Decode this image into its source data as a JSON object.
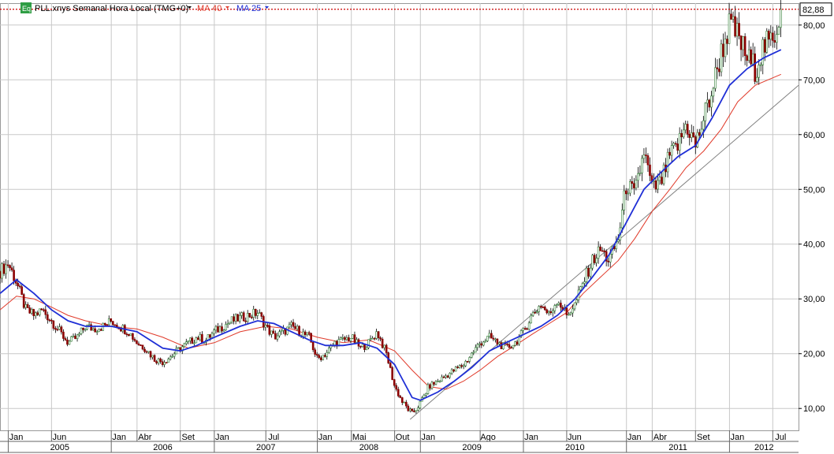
{
  "header": {
    "badge": "Eq",
    "symbol": "PLL.xnys Semanal Hora Local (TMG+0)",
    "ma40_label": "MA 40",
    "ma25_label": "MA 25"
  },
  "last_price": "82,88",
  "colors": {
    "candle_up": "#2e7d32",
    "candle_down": "#8b0000",
    "ma25": "#1f2fd6",
    "ma40": "#e03a2a",
    "trendline": "#808080",
    "last_price_line": "#cc0000",
    "grid": "#c8c8c8",
    "badge_bg": "#2f9e44"
  },
  "chart_data": {
    "type": "candlestick",
    "title": "",
    "ylim": [
      6,
      84
    ],
    "y_ticks": [
      "10,00",
      "20,00",
      "30,00",
      "40,00",
      "50,00",
      "60,00",
      "70,00",
      "80,00"
    ],
    "y_tick_values": [
      10,
      20,
      30,
      40,
      50,
      60,
      70,
      80
    ],
    "x_range": [
      2004.92,
      2012.67
    ],
    "month_ticks": [
      {
        "label": "Jan",
        "t": 2005.0
      },
      {
        "label": "Jun",
        "t": 2005.42
      },
      {
        "label": "Jan",
        "t": 2006.0
      },
      {
        "label": "Abr",
        "t": 2006.25
      },
      {
        "label": "Set",
        "t": 2006.67
      },
      {
        "label": "Jan",
        "t": 2007.0
      },
      {
        "label": "Jul",
        "t": 2007.5
      },
      {
        "label": "Jan",
        "t": 2008.0
      },
      {
        "label": "Mai",
        "t": 2008.33
      },
      {
        "label": "Out",
        "t": 2008.75
      },
      {
        "label": "Jan",
        "t": 2009.0
      },
      {
        "label": "Ago",
        "t": 2009.58
      },
      {
        "label": "Jan",
        "t": 2010.0
      },
      {
        "label": "Jun",
        "t": 2010.42
      },
      {
        "label": "Jan",
        "t": 2011.0
      },
      {
        "label": "Abr",
        "t": 2011.25
      },
      {
        "label": "Set",
        "t": 2011.67
      },
      {
        "label": "Jan",
        "t": 2012.0
      },
      {
        "label": "Jul",
        "t": 2012.42
      }
    ],
    "year_ticks": [
      {
        "label": "2005",
        "t": 2005.0
      },
      {
        "label": "2006",
        "t": 2006.0
      },
      {
        "label": "2007",
        "t": 2007.0
      },
      {
        "label": "2008",
        "t": 2008.0
      },
      {
        "label": "2009",
        "t": 2009.0
      },
      {
        "label": "2010",
        "t": 2010.0
      },
      {
        "label": "2011",
        "t": 2011.0
      },
      {
        "label": "2012",
        "t": 2012.0
      }
    ],
    "close_series": [
      [
        2004.92,
        35
      ],
      [
        2005.0,
        36.5
      ],
      [
        2005.08,
        33
      ],
      [
        2005.17,
        28
      ],
      [
        2005.25,
        27
      ],
      [
        2005.33,
        28
      ],
      [
        2005.42,
        26
      ],
      [
        2005.5,
        24
      ],
      [
        2005.58,
        22
      ],
      [
        2005.67,
        23
      ],
      [
        2005.75,
        25
      ],
      [
        2005.83,
        24.5
      ],
      [
        2005.92,
        25
      ],
      [
        2006.0,
        26
      ],
      [
        2006.08,
        25
      ],
      [
        2006.17,
        24
      ],
      [
        2006.25,
        22
      ],
      [
        2006.33,
        21
      ],
      [
        2006.42,
        19
      ],
      [
        2006.5,
        18.5
      ],
      [
        2006.58,
        19.5
      ],
      [
        2006.67,
        21
      ],
      [
        2006.75,
        22
      ],
      [
        2006.83,
        23
      ],
      [
        2006.92,
        22.5
      ],
      [
        2007.0,
        24
      ],
      [
        2007.08,
        25
      ],
      [
        2007.17,
        26
      ],
      [
        2007.25,
        26.5
      ],
      [
        2007.33,
        27
      ],
      [
        2007.42,
        27.5
      ],
      [
        2007.5,
        25
      ],
      [
        2007.58,
        23
      ],
      [
        2007.67,
        24
      ],
      [
        2007.75,
        25
      ],
      [
        2007.83,
        24
      ],
      [
        2007.92,
        23
      ],
      [
        2008.0,
        19
      ],
      [
        2008.08,
        20
      ],
      [
        2008.17,
        22
      ],
      [
        2008.25,
        22.5
      ],
      [
        2008.33,
        23
      ],
      [
        2008.42,
        21
      ],
      [
        2008.5,
        22
      ],
      [
        2008.58,
        24
      ],
      [
        2008.67,
        20
      ],
      [
        2008.75,
        14
      ],
      [
        2008.83,
        11
      ],
      [
        2008.92,
        9
      ],
      [
        2009.0,
        11
      ],
      [
        2009.08,
        14
      ],
      [
        2009.17,
        15
      ],
      [
        2009.25,
        16
      ],
      [
        2009.33,
        17
      ],
      [
        2009.42,
        18
      ],
      [
        2009.5,
        20
      ],
      [
        2009.58,
        22
      ],
      [
        2009.67,
        23
      ],
      [
        2009.75,
        22
      ],
      [
        2009.83,
        21
      ],
      [
        2009.92,
        22
      ],
      [
        2010.0,
        24
      ],
      [
        2010.08,
        27
      ],
      [
        2010.17,
        29
      ],
      [
        2010.25,
        27
      ],
      [
        2010.33,
        30
      ],
      [
        2010.42,
        27
      ],
      [
        2010.5,
        29
      ],
      [
        2010.58,
        33
      ],
      [
        2010.67,
        37
      ],
      [
        2010.75,
        39
      ],
      [
        2010.83,
        37
      ],
      [
        2010.92,
        41
      ],
      [
        2011.0,
        51
      ],
      [
        2011.08,
        49
      ],
      [
        2011.17,
        57
      ],
      [
        2011.25,
        50
      ],
      [
        2011.33,
        51
      ],
      [
        2011.42,
        56
      ],
      [
        2011.5,
        58
      ],
      [
        2011.58,
        62
      ],
      [
        2011.67,
        58
      ],
      [
        2011.75,
        63
      ],
      [
        2011.83,
        68
      ],
      [
        2011.92,
        75
      ],
      [
        2012.0,
        80
      ],
      [
        2012.08,
        78
      ],
      [
        2012.17,
        74
      ],
      [
        2012.25,
        72
      ],
      [
        2012.33,
        76
      ],
      [
        2012.42,
        77
      ],
      [
        2012.5,
        82.88
      ]
    ],
    "ma25_series": [
      [
        2004.92,
        31
      ],
      [
        2005.08,
        33.5
      ],
      [
        2005.25,
        31
      ],
      [
        2005.42,
        28
      ],
      [
        2005.58,
        26
      ],
      [
        2005.75,
        25
      ],
      [
        2006.0,
        25
      ],
      [
        2006.25,
        24
      ],
      [
        2006.5,
        21
      ],
      [
        2006.67,
        20.5
      ],
      [
        2006.83,
        21.5
      ],
      [
        2007.0,
        23
      ],
      [
        2007.25,
        25
      ],
      [
        2007.42,
        26
      ],
      [
        2007.58,
        25.5
      ],
      [
        2007.75,
        24
      ],
      [
        2007.92,
        22.5
      ],
      [
        2008.08,
        21.5
      ],
      [
        2008.25,
        21.5
      ],
      [
        2008.42,
        22
      ],
      [
        2008.58,
        21
      ],
      [
        2008.75,
        18
      ],
      [
        2008.92,
        12
      ],
      [
        2009.0,
        11.5
      ],
      [
        2009.17,
        13
      ],
      [
        2009.33,
        15
      ],
      [
        2009.5,
        17.5
      ],
      [
        2009.67,
        20.5
      ],
      [
        2009.83,
        22
      ],
      [
        2010.0,
        23.5
      ],
      [
        2010.17,
        25
      ],
      [
        2010.33,
        27
      ],
      [
        2010.5,
        30
      ],
      [
        2010.67,
        34
      ],
      [
        2010.83,
        38
      ],
      [
        2011.0,
        44
      ],
      [
        2011.17,
        50
      ],
      [
        2011.33,
        53
      ],
      [
        2011.5,
        56
      ],
      [
        2011.67,
        58
      ],
      [
        2011.83,
        63
      ],
      [
        2012.0,
        69
      ],
      [
        2012.17,
        72
      ],
      [
        2012.33,
        74
      ],
      [
        2012.5,
        75.5
      ]
    ],
    "ma40_series": [
      [
        2004.92,
        28
      ],
      [
        2005.08,
        30.5
      ],
      [
        2005.25,
        30
      ],
      [
        2005.42,
        28.5
      ],
      [
        2005.58,
        27
      ],
      [
        2005.75,
        26
      ],
      [
        2006.0,
        25
      ],
      [
        2006.25,
        24.5
      ],
      [
        2006.5,
        23
      ],
      [
        2006.75,
        21
      ],
      [
        2007.0,
        22
      ],
      [
        2007.25,
        24
      ],
      [
        2007.5,
        25
      ],
      [
        2007.75,
        24.5
      ],
      [
        2008.0,
        23
      ],
      [
        2008.25,
        22
      ],
      [
        2008.5,
        22.5
      ],
      [
        2008.75,
        20.5
      ],
      [
        2008.92,
        17
      ],
      [
        2009.08,
        14
      ],
      [
        2009.25,
        13.5
      ],
      [
        2009.42,
        15
      ],
      [
        2009.58,
        17
      ],
      [
        2009.75,
        19.5
      ],
      [
        2009.92,
        21.5
      ],
      [
        2010.08,
        23.5
      ],
      [
        2010.25,
        25.5
      ],
      [
        2010.42,
        27.5
      ],
      [
        2010.58,
        31
      ],
      [
        2010.75,
        34
      ],
      [
        2010.92,
        37
      ],
      [
        2011.08,
        41
      ],
      [
        2011.25,
        46
      ],
      [
        2011.42,
        50
      ],
      [
        2011.58,
        54
      ],
      [
        2011.75,
        57
      ],
      [
        2011.92,
        61
      ],
      [
        2012.08,
        66
      ],
      [
        2012.25,
        69
      ],
      [
        2012.5,
        71
      ]
    ],
    "trendline": {
      "from": [
        2008.9,
        8
      ],
      "to": [
        2012.67,
        69
      ]
    },
    "last_value": 82.88
  }
}
